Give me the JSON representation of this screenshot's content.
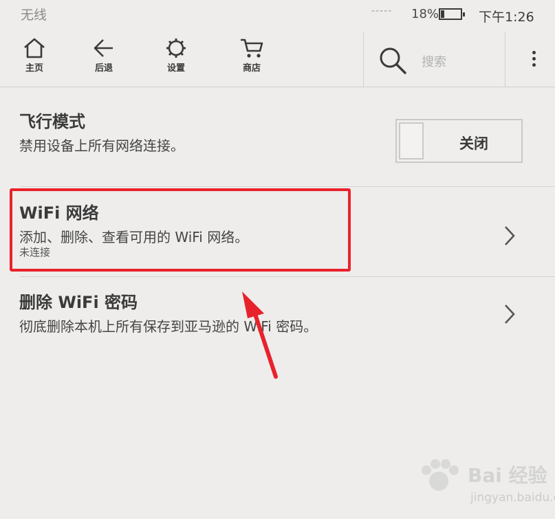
{
  "status_bar": {
    "network": "无线",
    "battery_percent": "18%",
    "battery_level": 0.18,
    "time": "下午1:26"
  },
  "toolbar": {
    "items": [
      {
        "label": "主页",
        "icon": "home-icon"
      },
      {
        "label": "后退",
        "icon": "back-arrow-icon"
      },
      {
        "label": "设置",
        "icon": "gear-icon"
      },
      {
        "label": "商店",
        "icon": "cart-icon"
      }
    ],
    "search_placeholder": "搜索",
    "menu_icon": "more-vertical-icon"
  },
  "settings": {
    "airplane": {
      "title": "飞行模式",
      "description": "禁用设备上所有网络连接。",
      "toggle_label": "关闭",
      "enabled": false
    },
    "wifi": {
      "title": "WiFi 网络",
      "description": "添加、删除、查看可用的 WiFi 网络。",
      "status": "未连接"
    },
    "delete_passwords": {
      "title": "删除 WiFi 密码",
      "description": "彻底删除本机上所有保存到亚马逊的 WiFi 密码。"
    }
  },
  "annotation": {
    "color": "#e8222c"
  },
  "watermark": {
    "brand": "Bai  经验",
    "url": "jingyan.baidu.com"
  }
}
